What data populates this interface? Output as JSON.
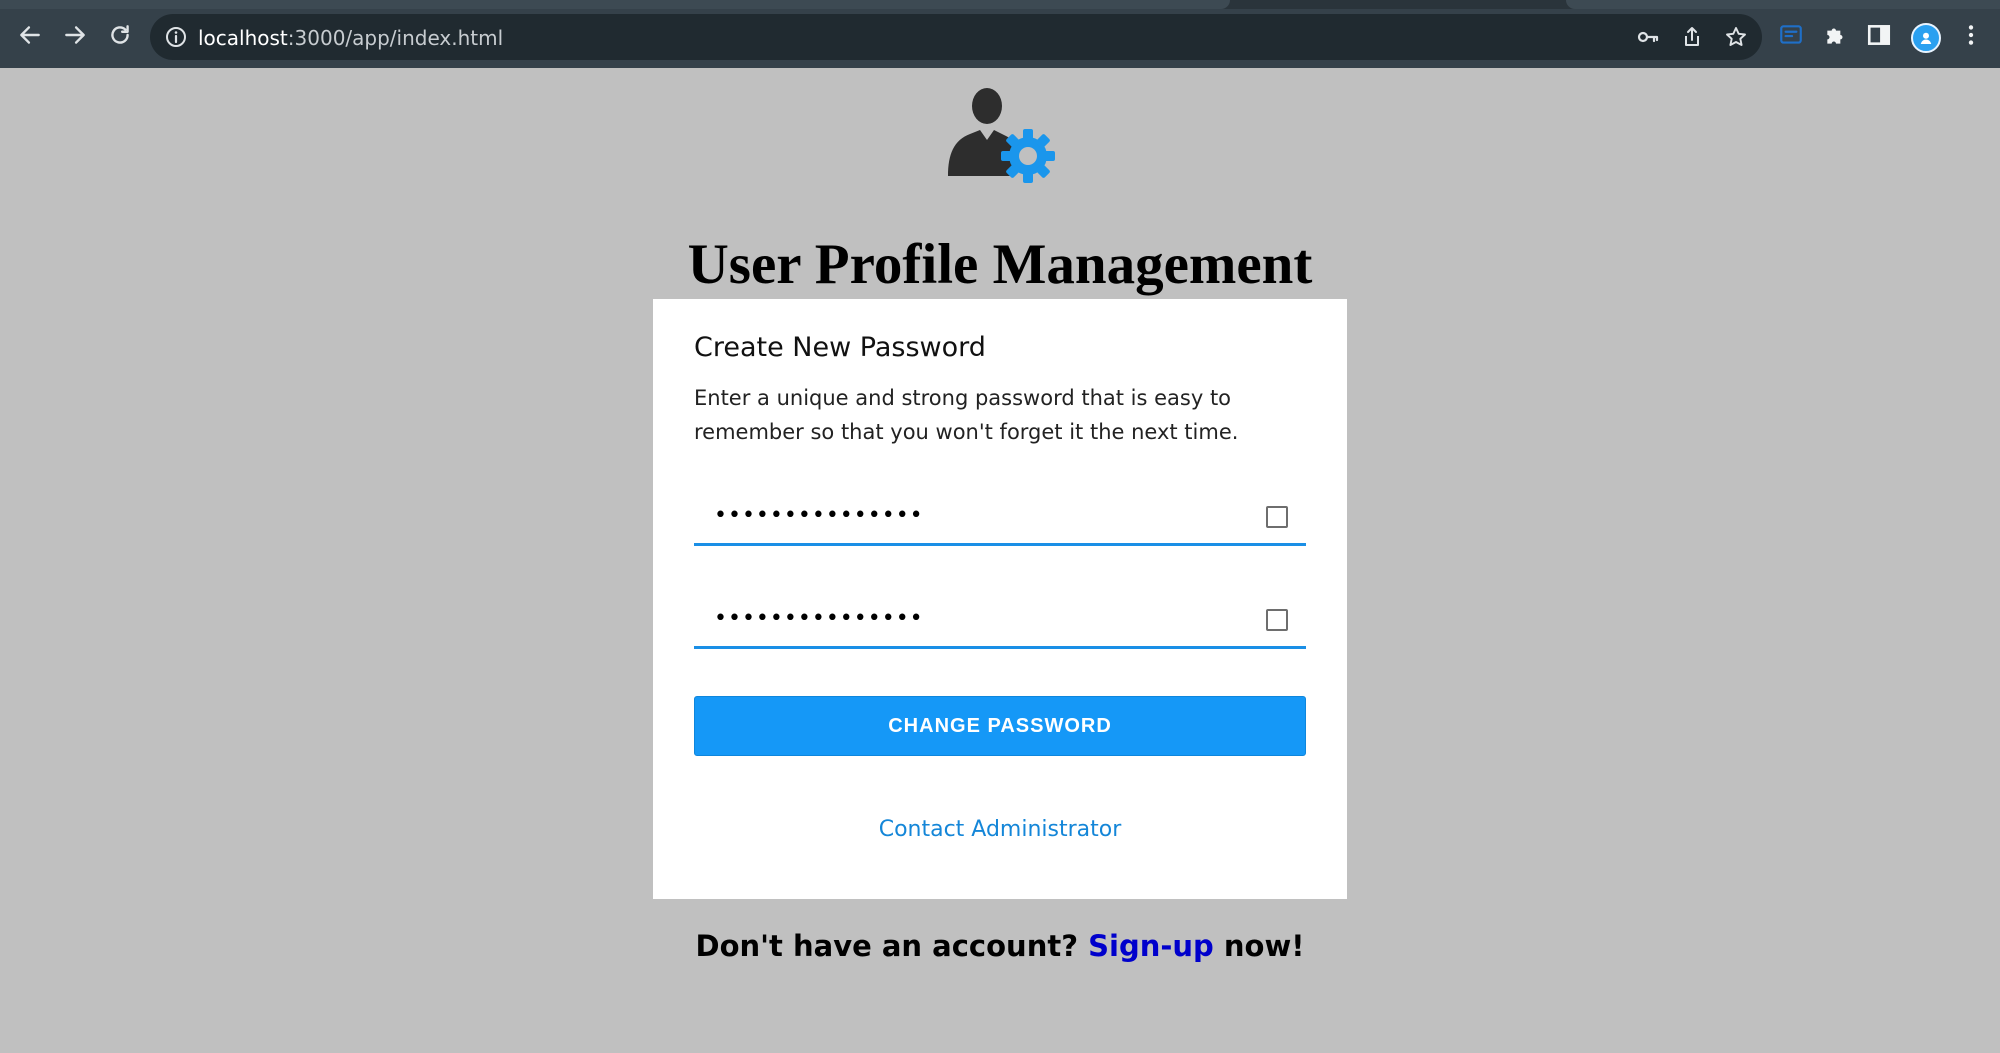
{
  "browser": {
    "url_host": "localhost",
    "url_path": ":3000/app/index.html",
    "icons": [
      "back-arrow-icon",
      "forward-arrow-icon",
      "reload-icon",
      "info-icon",
      "key-icon",
      "share-icon",
      "star-icon",
      "extension-icon",
      "puzzle-icon",
      "side-panel-icon",
      "profile-avatar",
      "more-vert-icon"
    ]
  },
  "header": {
    "logo_icon": "user-gear-icon",
    "title": "User Profile Management"
  },
  "card": {
    "title": "Create New Password",
    "description": "Enter a unique and strong password that is easy to remember so that you won't forget it the next time.",
    "new_password": {
      "value": "•••••••••••••••",
      "show_toggle_icon": "checkbox-icon"
    },
    "confirm_password": {
      "value": "•••••••••••••••",
      "show_toggle_icon": "checkbox-icon"
    },
    "submit_label": "CHANGE PASSWORD",
    "contact_link": "Contact Administrator"
  },
  "footer": {
    "prefix": "Don't have an account? ",
    "link": "Sign-up",
    "suffix": " now!"
  },
  "colors": {
    "page_bg": "#c0c0c0",
    "accent": "#1598f7",
    "link": "#0000cc"
  }
}
